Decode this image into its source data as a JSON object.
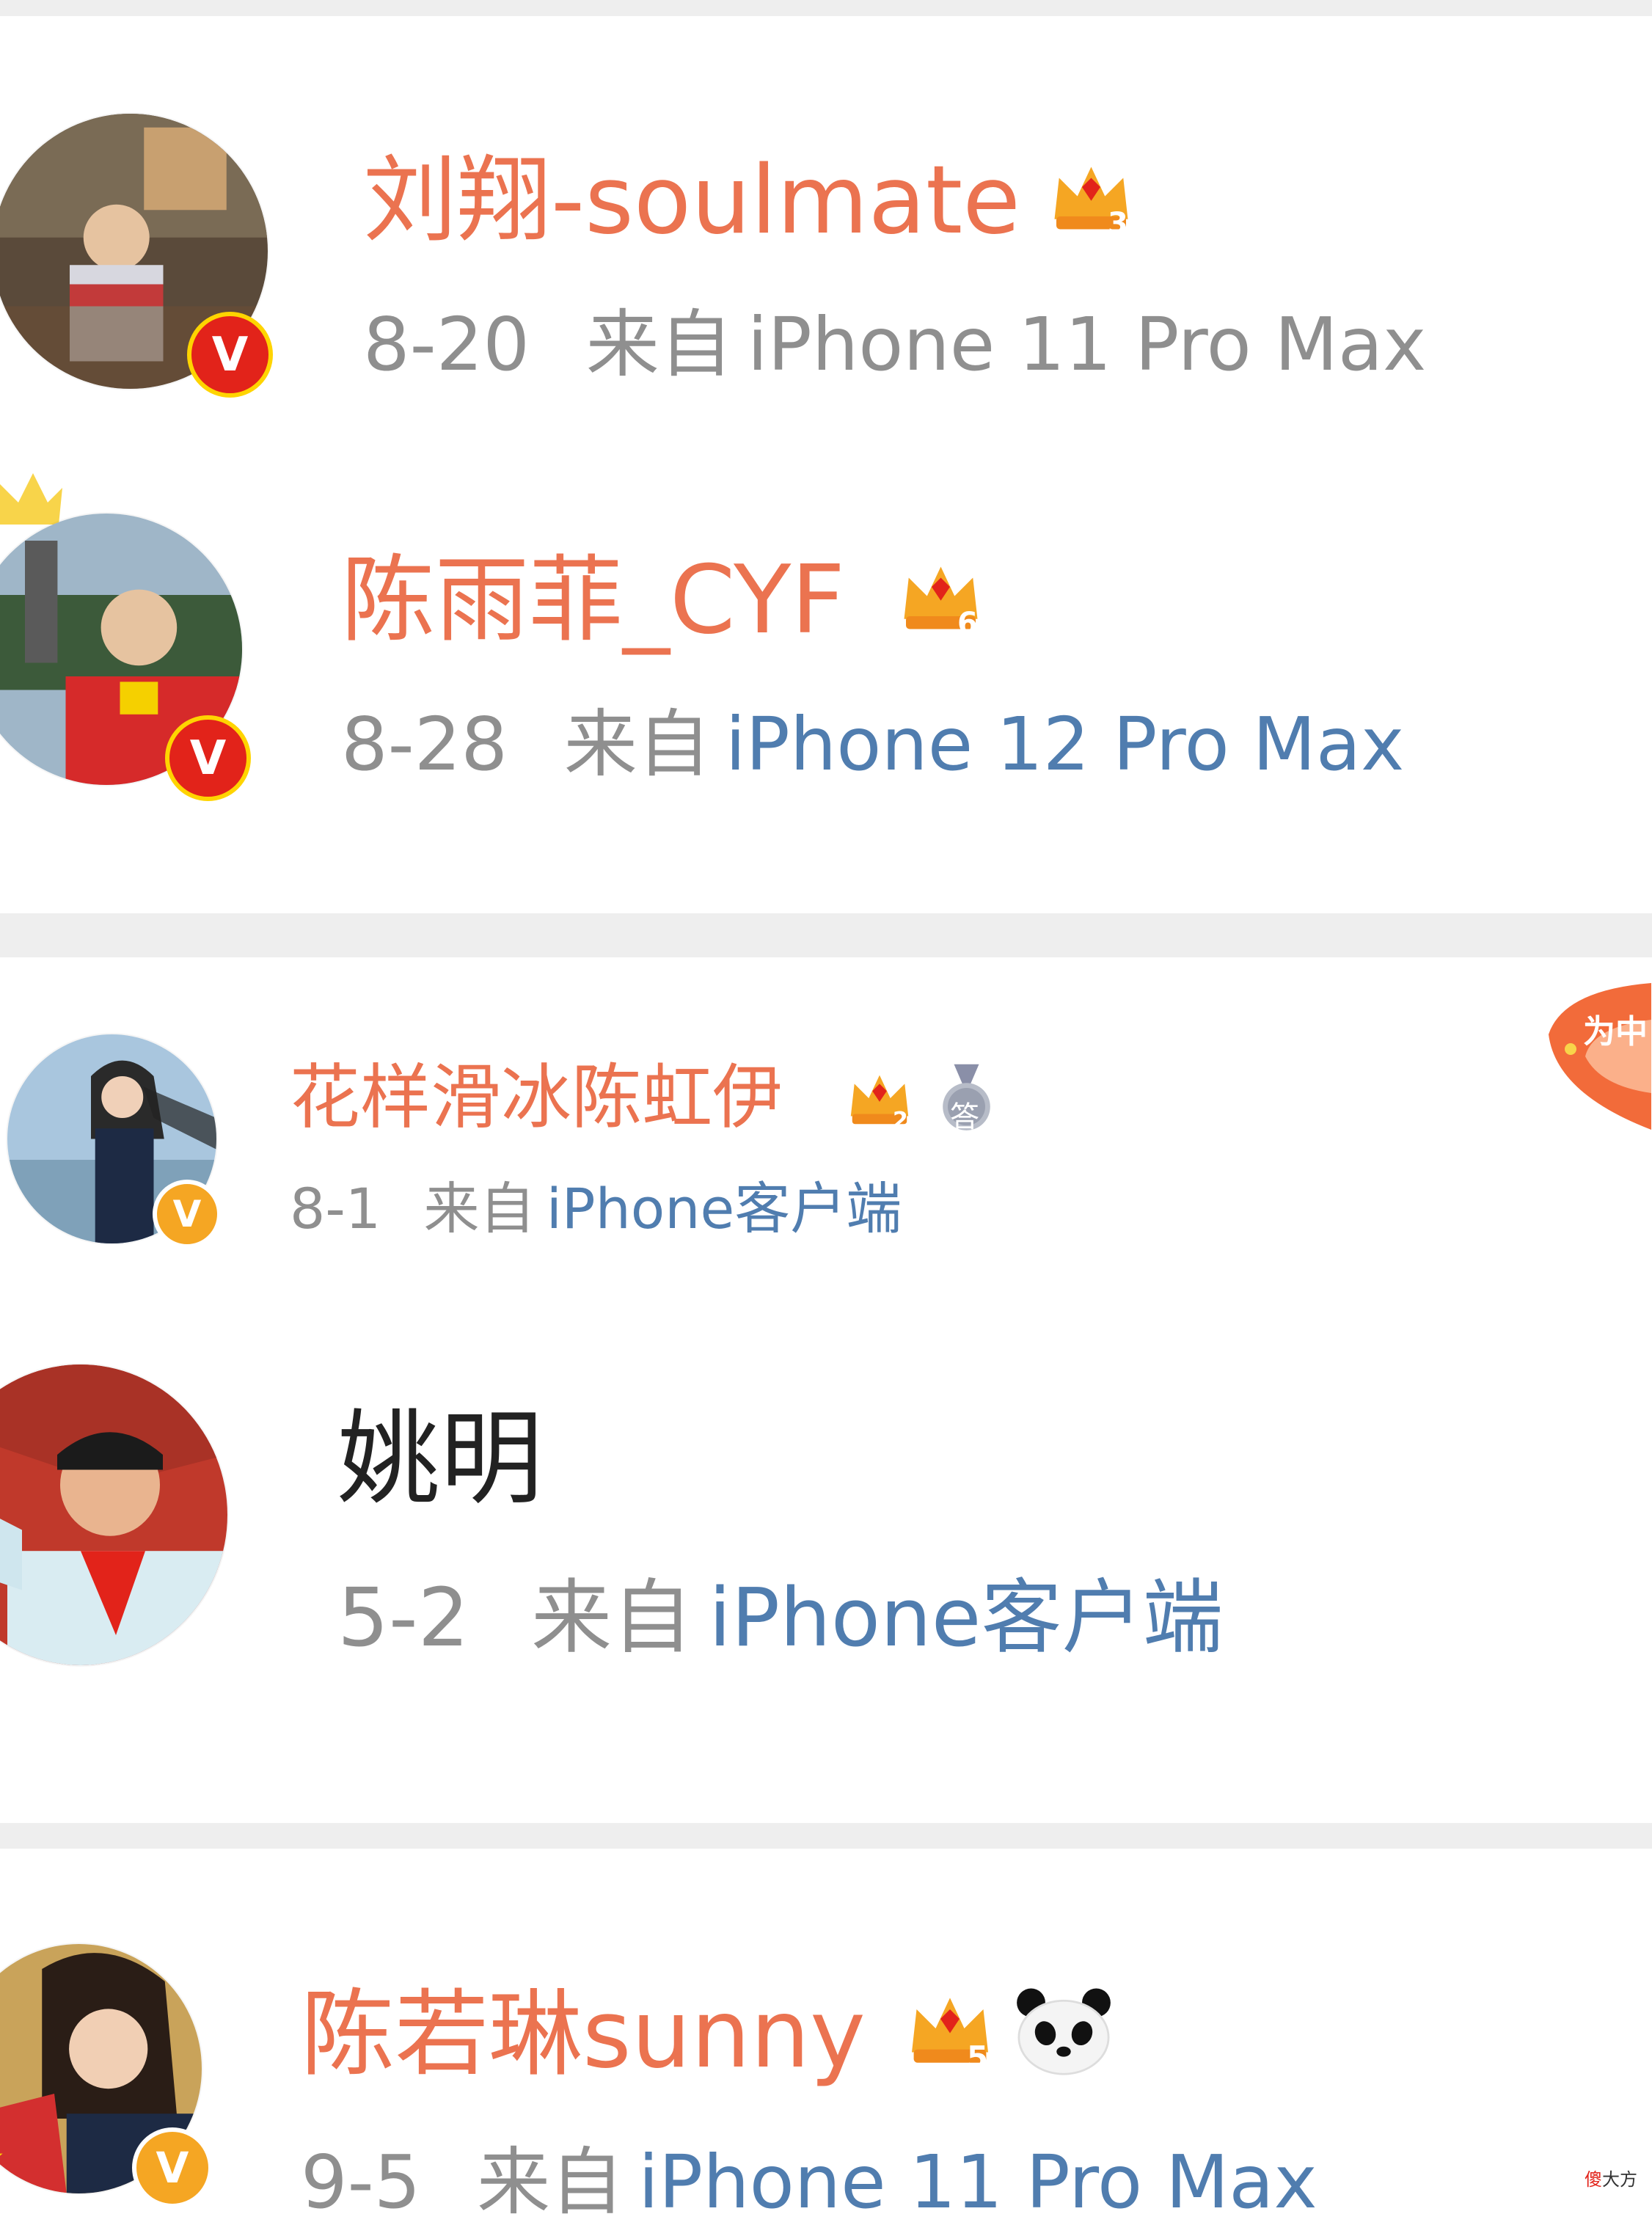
{
  "colors": {
    "name_orange": "#eb7350",
    "meta_gray": "#8f8f8f",
    "link_blue": "#507daf",
    "verified_red": "#e2231a",
    "verified_gold": "#f5a623",
    "divider": "#eeeeee"
  },
  "comments": [
    {
      "name": "刘翔-soulmate",
      "crown_level": "3",
      "verified": "red",
      "date": "8-20",
      "source_prefix": "来自",
      "source": "iPhone 11 Pro Max",
      "source_color": "gray"
    },
    {
      "name": "陈雨菲_CYF",
      "crown_level": "6",
      "verified": "red",
      "date": "8-28",
      "source_prefix": "来自",
      "source": "iPhone 12 Pro Max",
      "source_color": "blue"
    },
    {
      "name": "花样滑冰陈虹伊",
      "crown_level": "2",
      "medal_text": "答",
      "verified": "gold",
      "date": "8-1",
      "source_prefix": "来自",
      "source": "iPhone客户端",
      "source_color": "blue",
      "side_badge_text": "为中"
    },
    {
      "name": "姚明",
      "verified": "none",
      "date": "5-2",
      "source_prefix": "来自",
      "source": "iPhone客户端",
      "source_color": "blue"
    },
    {
      "name": "陈若琳sunny",
      "crown_level": "5",
      "extra_icon": "panda-icon",
      "verified": "gold",
      "date": "9-5",
      "source_prefix": "来自",
      "source": "iPhone 11 Pro Max",
      "source_color": "blue"
    }
  ],
  "watermark": {
    "red_char": "傻",
    "rest": "大方"
  },
  "verified_letter": "V"
}
